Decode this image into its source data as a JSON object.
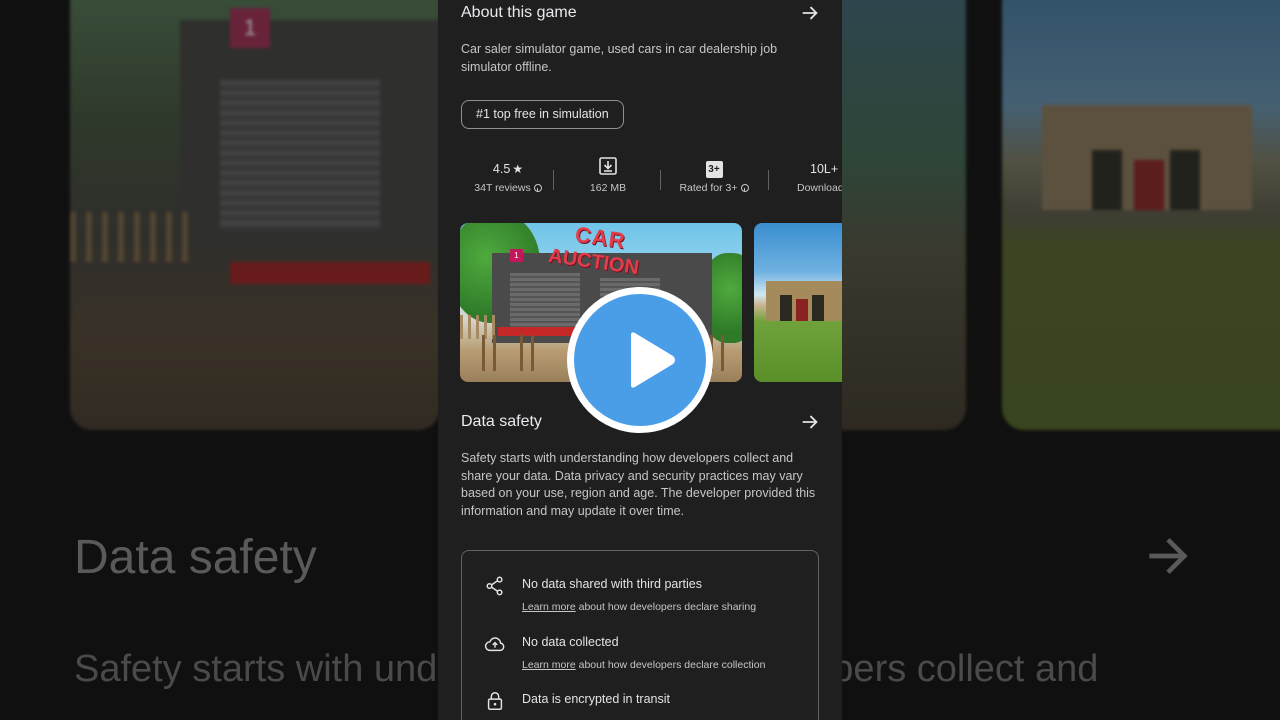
{
  "background": {
    "title": "Data safety",
    "body_left": "Safety starts with und",
    "body_right": "pers collect and"
  },
  "about": {
    "title": "About this game",
    "description": "Car saler simulator game, used cars in car dealership job simulator offline.",
    "chip": "#1 top free in simulation"
  },
  "stats": {
    "rating": "4.5",
    "star": "★",
    "reviews": "34T reviews",
    "size": "162 MB",
    "content_rating_badge": "3+",
    "content_rating": "Rated for 3+",
    "downloads": "10L+",
    "downloads_label": "Download"
  },
  "screenshots": {
    "title_line1": "CAR",
    "title_line2": "AUCTION",
    "sign": "1"
  },
  "data_safety": {
    "title": "Data safety",
    "description": "Safety starts with understanding how developers collect and share your data. Data privacy and security practices may vary based on your use, region and age. The developer provided this information and may update it over time.",
    "items": [
      {
        "label": "No data shared with third parties",
        "link": "Learn more",
        "sub": " about how developers declare sharing"
      },
      {
        "label": "No data collected",
        "link": "Learn more",
        "sub": " about how developers declare collection"
      },
      {
        "label": "Data is encrypted in transit"
      }
    ]
  },
  "icons": {
    "arrow": "arrow-right-icon",
    "download": "download-icon",
    "share": "share-icon",
    "cloud": "cloud-upload-icon",
    "lock": "lock-icon",
    "play": "play-icon"
  },
  "colors": {
    "panel": "#1f1f1f",
    "play_blue": "#4a9ee8"
  }
}
